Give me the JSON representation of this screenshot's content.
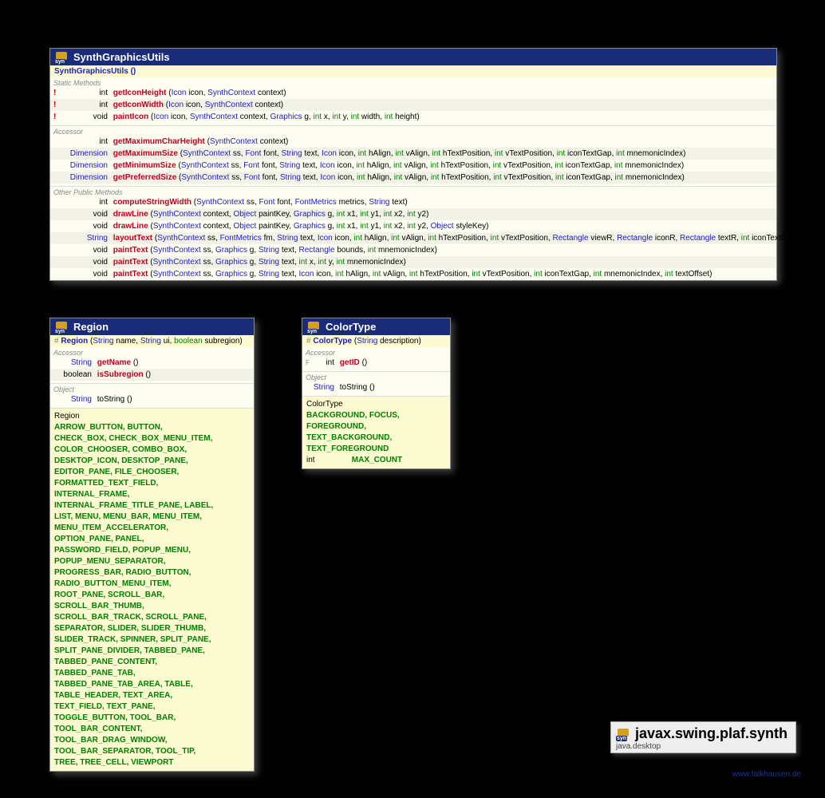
{
  "package": {
    "name": "javax.swing.plaf.synth",
    "module": "java.desktop"
  },
  "watermark": "www.falkhausen.de",
  "classes": {
    "sgu": {
      "title": "SynthGraphicsUtils",
      "constructor": "SynthGraphicsUtils ()",
      "sections": {
        "static": "Static Methods",
        "accessor": "Accessor",
        "other": "Other Public Methods"
      },
      "m": {
        "gih": {
          "ret": "int",
          "name": "getIconHeight",
          "sig": "(Icon icon, SynthContext context)",
          "bang": true
        },
        "giw": {
          "ret": "int",
          "name": "getIconWidth",
          "sig": "(Icon icon, SynthContext context)",
          "bang": true
        },
        "pi": {
          "ret": "void",
          "name": "paintIcon",
          "sig": "(Icon icon, SynthContext context, Graphics g, int x, int y, int width, int height)",
          "bang": true
        },
        "gmch": {
          "ret": "int",
          "name": "getMaximumCharHeight",
          "sig": "(SynthContext context)"
        },
        "gmax": {
          "ret": "Dimension",
          "name": "getMaximumSize",
          "sig": "(SynthContext ss, Font font, String text, Icon icon, int hAlign, int vAlign, int hTextPosition, int vTextPosition, int iconTextGap, int mnemonicIndex)"
        },
        "gmin": {
          "ret": "Dimension",
          "name": "getMinimumSize",
          "sig": "(SynthContext ss, Font font, String text, Icon icon, int hAlign, int vAlign, int hTextPosition, int vTextPosition, int iconTextGap, int mnemonicIndex)"
        },
        "gprf": {
          "ret": "Dimension",
          "name": "getPreferredSize",
          "sig": "(SynthContext ss, Font font, String text, Icon icon, int hAlign, int vAlign, int hTextPosition, int vTextPosition, int iconTextGap, int mnemonicIndex)"
        },
        "csw": {
          "ret": "int",
          "name": "computeStringWidth",
          "sig": "(SynthContext ss, Font font, FontMetrics metrics, String text)"
        },
        "dl1": {
          "ret": "void",
          "name": "drawLine",
          "sig": "(SynthContext context, Object paintKey, Graphics g, int x1, int y1, int x2, int y2)"
        },
        "dl2": {
          "ret": "void",
          "name": "drawLine",
          "sig": "(SynthContext context, Object paintKey, Graphics g, int x1, int y1, int x2, int y2, Object styleKey)"
        },
        "lt": {
          "ret": "String",
          "name": "layoutText",
          "sig": "(SynthContext ss, FontMetrics fm, String text, Icon icon, int hAlign, int vAlign, int hTextPosition, int vTextPosition, Rectangle viewR, Rectangle iconR, Rectangle textR, int iconTextGap)"
        },
        "pt1": {
          "ret": "void",
          "name": "paintText",
          "sig": "(SynthContext ss, Graphics g, String text, Rectangle bounds, int mnemonicIndex)"
        },
        "pt2": {
          "ret": "void",
          "name": "paintText",
          "sig": "(SynthContext ss, Graphics g, String text, int x, int y, int mnemonicIndex)"
        },
        "pt3": {
          "ret": "void",
          "name": "paintText",
          "sig": "(SynthContext ss, Graphics g, String text, Icon icon, int hAlign, int vAlign, int hTextPosition, int vTextPosition, int iconTextGap, int mnemonicIndex, int textOffset)"
        }
      }
    },
    "region": {
      "title": "Region",
      "constructor_prefix": "# Region",
      "constructor_sig": "(String name, String ui, boolean subregion)",
      "sections": {
        "accessor": "Accessor",
        "object": "Object"
      },
      "m": {
        "gn": {
          "ret": "String",
          "name": "getName",
          "sig": "()"
        },
        "is": {
          "ret": "boolean",
          "name": "isSubregion",
          "sig": "()"
        },
        "ts": {
          "ret": "String",
          "name": "toString",
          "sig": "()"
        }
      },
      "field_type": "Region",
      "fields": "ARROW_BUTTON, BUTTON, CHECK_BOX, CHECK_BOX_MENU_ITEM, COLOR_CHOOSER, COMBO_BOX, DESKTOP_ICON, DESKTOP_PANE, EDITOR_PANE, FILE_CHOOSER, FORMATTED_TEXT_FIELD, INTERNAL_FRAME, INTERNAL_FRAME_TITLE_PANE, LABEL, LIST, MENU, MENU_BAR, MENU_ITEM, MENU_ITEM_ACCELERATOR, OPTION_PANE, PANEL, PASSWORD_FIELD, POPUP_MENU, POPUP_MENU_SEPARATOR, PROGRESS_BAR, RADIO_BUTTON, RADIO_BUTTON_MENU_ITEM, ROOT_PANE, SCROLL_BAR, SCROLL_BAR_THUMB, SCROLL_BAR_TRACK, SCROLL_PANE, SEPARATOR, SLIDER, SLIDER_THUMB, SLIDER_TRACK, SPINNER, SPLIT_PANE, SPLIT_PANE_DIVIDER, TABBED_PANE, TABBED_PANE_CONTENT, TABBED_PANE_TAB, TABBED_PANE_TAB_AREA, TABLE, TABLE_HEADER, TEXT_AREA, TEXT_FIELD, TEXT_PANE, TOGGLE_BUTTON, TOOL_BAR, TOOL_BAR_CONTENT, TOOL_BAR_DRAG_WINDOW, TOOL_BAR_SEPARATOR, TOOL_TIP, TREE, TREE_CELL, VIEWPORT"
    },
    "colortype": {
      "title": "ColorType",
      "constructor_prefix": "# ColorType",
      "constructor_sig": "(String description)",
      "sections": {
        "accessor": "Accessor",
        "object": "Object"
      },
      "m": {
        "gid": {
          "ret": "int",
          "name": "getID",
          "sig": "()",
          "final": true
        },
        "ts": {
          "ret": "String",
          "name": "toString",
          "sig": "()"
        }
      },
      "field_type1": "ColorType",
      "fields1": "BACKGROUND, FOCUS, FOREGROUND, TEXT_BACKGROUND, TEXT_FOREGROUND",
      "field_type2": "int",
      "fields2": "MAX_COUNT"
    }
  }
}
